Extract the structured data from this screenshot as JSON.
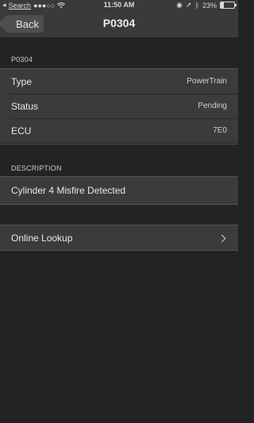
{
  "status_bar": {
    "carrier": "Search",
    "signal_dots": "●●●○○",
    "time": "11:50 AM",
    "battery": "23%",
    "battery_level": 0.23
  },
  "nav": {
    "back_label": "Back",
    "title": "P0304"
  },
  "code_section": {
    "header": "P0304",
    "rows": [
      {
        "label": "Type",
        "value": "PowerTrain"
      },
      {
        "label": "Status",
        "value": "Pending"
      },
      {
        "label": "ECU",
        "value": "7E0"
      }
    ]
  },
  "description_section": {
    "header": "DESCRIPTION",
    "text": "Cylinder 4 Misfire Detected"
  },
  "lookup": {
    "label": "Online Lookup"
  },
  "colors": {
    "background": "#232323",
    "nav_bar": "#3a3a3a",
    "cell": "#3b3b3b"
  }
}
